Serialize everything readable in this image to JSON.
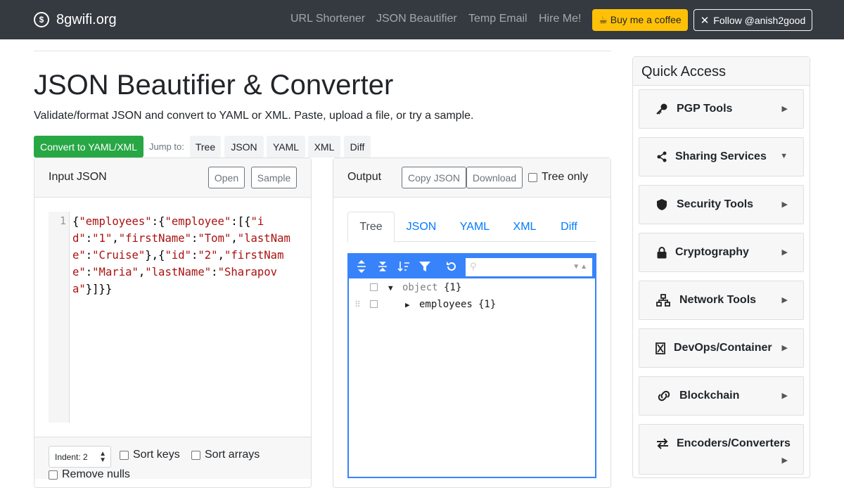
{
  "nav": {
    "brand": "8gwifi.org",
    "links": [
      "URL Shortener",
      "JSON Beautifier",
      "Temp Email",
      "Hire Me!"
    ],
    "coffee": "☕ Buy me a coffee",
    "follow": "Follow @anish2good"
  },
  "page": {
    "title": "JSON Beautifier & Converter",
    "subtitle": "Validate/format JSON and convert to YAML or XML. Paste, upload a file, or try a sample."
  },
  "toolbar": {
    "convert": "Convert to YAML/XML",
    "jump_label": "Jump to:",
    "jump": [
      "Tree",
      "JSON",
      "YAML",
      "XML",
      "Diff"
    ]
  },
  "input": {
    "title": "Input JSON",
    "open": "Open",
    "sample": "Sample",
    "line_number": "1",
    "code_tokens": [
      {
        "t": "{",
        "c": "p"
      },
      {
        "t": "\"employees\"",
        "c": "s"
      },
      {
        "t": ":{",
        "c": "p"
      },
      {
        "t": "\"employee\"",
        "c": "s"
      },
      {
        "t": ":[{",
        "c": "p"
      },
      {
        "t": "\"id\"",
        "c": "s"
      },
      {
        "t": ":",
        "c": "p"
      },
      {
        "t": "\"1\"",
        "c": "s"
      },
      {
        "t": ",",
        "c": "p"
      },
      {
        "t": "\"firstName\"",
        "c": "s"
      },
      {
        "t": ":",
        "c": "p"
      },
      {
        "t": "\"Tom\"",
        "c": "s"
      },
      {
        "t": ",",
        "c": "p"
      },
      {
        "t": "\"lastName\"",
        "c": "s"
      },
      {
        "t": ":",
        "c": "p"
      },
      {
        "t": "\"Cruise\"",
        "c": "s"
      },
      {
        "t": "},{",
        "c": "p"
      },
      {
        "t": "\"id\"",
        "c": "s"
      },
      {
        "t": ":",
        "c": "p"
      },
      {
        "t": "\"2\"",
        "c": "s"
      },
      {
        "t": ",",
        "c": "p"
      },
      {
        "t": "\"firstName\"",
        "c": "s"
      },
      {
        "t": ":",
        "c": "p"
      },
      {
        "t": "\"Maria\"",
        "c": "s"
      },
      {
        "t": ",",
        "c": "p"
      },
      {
        "t": "\"lastName\"",
        "c": "s"
      },
      {
        "t": ":",
        "c": "p"
      },
      {
        "t": "\"Sharapova\"",
        "c": "s"
      },
      {
        "t": "}]}}",
        "c": "p"
      }
    ],
    "indent": "Indent: 2",
    "sort_keys": "Sort keys",
    "sort_arrays": "Sort arrays",
    "remove_nulls": "Remove nulls"
  },
  "output": {
    "title": "Output",
    "copy": "Copy JSON",
    "download": "Download",
    "tree_only": "Tree only",
    "tabs": [
      "Tree",
      "JSON",
      "YAML",
      "XML",
      "Diff"
    ],
    "active_tab": "Tree",
    "tree": {
      "root_type": "object",
      "root_count": "{1}",
      "child_key": "employees",
      "child_count": "{1}"
    }
  },
  "quick_access": {
    "title": "Quick Access",
    "items": [
      {
        "label": "PGP Tools",
        "icon": "key-icon",
        "expanded": false
      },
      {
        "label": "Sharing Services",
        "icon": "share-icon",
        "expanded": true
      },
      {
        "label": "Security Tools",
        "icon": "shield-icon",
        "expanded": false
      },
      {
        "label": "Cryptography",
        "icon": "lock-icon",
        "expanded": false
      },
      {
        "label": "Network Tools",
        "icon": "network-icon",
        "expanded": false
      },
      {
        "label": "DevOps/Container",
        "icon": "docker-icon",
        "expanded": false
      },
      {
        "label": "Blockchain",
        "icon": "link-icon",
        "expanded": false
      },
      {
        "label": "Encoders/Converters",
        "icon": "exchange-icon",
        "expanded": false
      }
    ]
  },
  "colors": {
    "navbar": "#343a40",
    "success": "#28a745",
    "warning": "#ffc107",
    "link": "#007bff",
    "tree_accent": "#3883fa",
    "json_string": "#a11"
  }
}
